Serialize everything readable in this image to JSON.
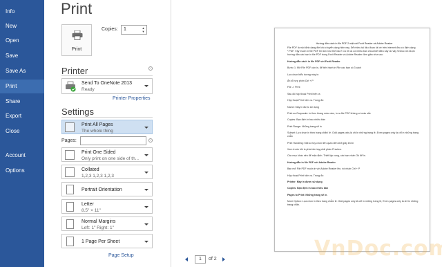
{
  "nav": {
    "items": [
      {
        "label": "Info"
      },
      {
        "label": "New"
      },
      {
        "label": "Open"
      },
      {
        "label": "Save"
      },
      {
        "label": "Save As"
      },
      {
        "label": "Print",
        "active": true
      },
      {
        "label": "Share"
      },
      {
        "label": "Export"
      },
      {
        "label": "Close"
      },
      {
        "label": "Account"
      },
      {
        "label": "Options"
      }
    ]
  },
  "panel": {
    "title": "Print",
    "print_button_label": "Print",
    "copies_label": "Copies:",
    "copies_value": "1",
    "printer_heading": "Printer",
    "printer_name": "Send To OneNote 2013",
    "printer_status": "Ready",
    "printer_properties_link": "Printer Properties",
    "settings_heading": "Settings",
    "print_what": {
      "title": "Print All Pages",
      "sub": "The whole thing"
    },
    "pages_label": "Pages:",
    "pages_value": "",
    "sided": {
      "title": "Print One Sided",
      "sub": "Only print on one side of th..."
    },
    "collated": {
      "title": "Collated",
      "sub": "1,2,3   1,2,3   1,2,3"
    },
    "orientation": {
      "title": "Portrait Orientation"
    },
    "paper": {
      "title": "Letter",
      "sub": "8.5\" × 11\""
    },
    "margins": {
      "title": "Normal Margins",
      "sub": "Left:  1\"    Right:  1\""
    },
    "per_sheet": {
      "title": "1 Page Per Sheet"
    },
    "page_setup_link": "Page Setup"
  },
  "preview": {
    "doc_title": "Hướng dẫn cách in file PDF 2 mặt với Foxit Reader và Adobe Reader",
    "intro": "File PDF là một định dạng file khó chuyển dụng hiện nay. Để nhiều tài liệu được tải về trên internet đều có định dạng *.PDF. Vậy muốn in file PDF thì làm như thế nào? Cả về cả có nhiều bạn chưa biết điều này do vậy VnDoc xin được hướng dẫn các bạn in file PDF trong Foxit Reader và Adobe Reader đơn giản như sau:",
    "lines": [
      {
        "text": "Hướng dẫn cách in file PDF với Foxit Reader",
        "bold": true
      },
      {
        "text": "Bước 1: Mở File PDF cần in, để tiến hành in File các bạn có 3 cách"
      },
      {
        "text": "Lựa chọn biểu tượng máy in"
      },
      {
        "text": "Ấn tổ hợp phím Ctrl + P"
      },
      {
        "text": "File -> Print"
      },
      {
        "text": "Sau đó hộp thoại Print hiện ra"
      },
      {
        "text": "Hộp thoại Print hiện ra. Trong đó:"
      },
      {
        "text": "Name: Máy in được sử dụng"
      },
      {
        "text": "Print as Grayscale: in theo thang màu xám, in ra file PDF không có màu sắc"
      },
      {
        "text": "Copies: Bạn định in bao nhiêu bản"
      },
      {
        "text": "Print Range: Những trang sẽ in"
      },
      {
        "text": "Subset: Lựa chọn in theo trang chẵn/ lẻ. Odd pages only là chỉ in những trang lẻ, Even pages only là chỉ in những trang chẵn"
      },
      {
        "text": "Print Handling: Một số tùy chọn liên quan đến khổ giấy khi in"
      },
      {
        "text": "Xem trước khi in phía bên tay phải phần Preview."
      },
      {
        "text": "Các mục khác nên để mặc định. Thiết lập xong, các bạn nhấn Ok để in."
      },
      {
        "text": "Hướng dẫn in file PDF với Adobe Reader",
        "bold": true
      },
      {
        "text": "Bạn mở File PDF muốn in với Adobe Reader lên, rồi nhấn Ctrl + P"
      },
      {
        "text": "Hộp thoại Print hiện ra. Trong đó:"
      },
      {
        "text": "Printer: Máy in được sử dụng",
        "bold": true
      },
      {
        "text": "Copies: Bạn định in bao nhiêu bản",
        "bold": true
      },
      {
        "text": "Pages to Print: Những trang sẽ in.",
        "bold": true
      },
      {
        "text": "More Option: Lựa chọn in theo trang chẵn/ lẻ. Odd pages only là chỉ in những trang lẻ, Even pages only là chỉ in những trang chẵn."
      }
    ],
    "pager": {
      "current": "1",
      "of_text": "of 2"
    },
    "watermark": "VnDoc.com"
  }
}
